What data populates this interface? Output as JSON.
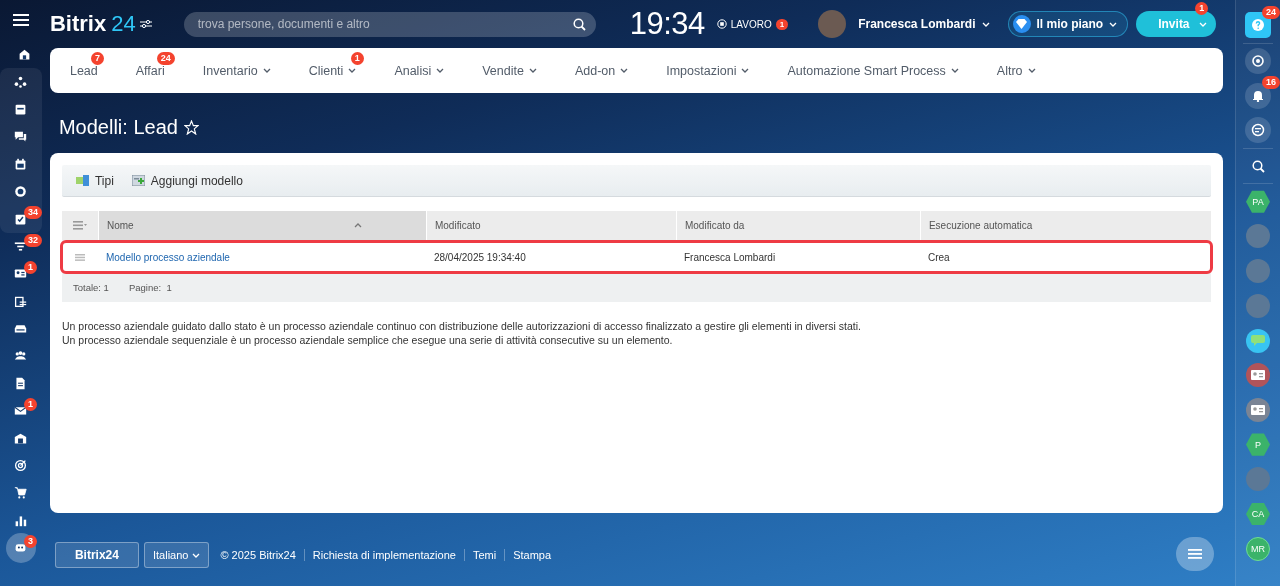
{
  "header": {
    "logo": {
      "word": "Bitrix",
      "number": "24"
    },
    "search": {
      "placeholder": "trova persone, documenti e altro"
    },
    "clock": "19:34",
    "work_status": {
      "label": "LAVORO",
      "badge": "1"
    },
    "user": {
      "name": "Francesca Lombardi"
    },
    "plan_button": "Il mio piano",
    "invite_button": {
      "label": "Invita",
      "badge": "1"
    }
  },
  "left_sidebar": {
    "badges": [
      "34",
      "32",
      "1",
      "1",
      "3"
    ]
  },
  "nav": {
    "items": [
      {
        "label": "Lead",
        "badge": "7",
        "dropdown": false
      },
      {
        "label": "Affari",
        "badge": "24",
        "dropdown": false
      },
      {
        "label": "Inventario",
        "dropdown": true
      },
      {
        "label": "Clienti",
        "badge": "1",
        "dropdown": true
      },
      {
        "label": "Analisi",
        "dropdown": true
      },
      {
        "label": "Vendite",
        "dropdown": true
      },
      {
        "label": "Add-on",
        "dropdown": true
      },
      {
        "label": "Impostazioni",
        "dropdown": true
      },
      {
        "label": "Automazione Smart Process",
        "dropdown": true
      },
      {
        "label": "Altro",
        "dropdown": true
      }
    ]
  },
  "page_title": "Modelli: Lead",
  "toolbar": [
    "Tipi",
    "Aggiungi modello"
  ],
  "table": {
    "columns": [
      {
        "label": "Nome",
        "sorted": true
      },
      {
        "label": "Modificato",
        "sorted": false
      },
      {
        "label": "Modificato da",
        "sorted": false
      },
      {
        "label": "Esecuzione automatica",
        "sorted": false
      }
    ],
    "rows": [
      {
        "highlighted": true,
        "cells": [
          "Modello processo aziendale",
          "28/04/2025 19:34:40",
          "Francesca Lombardi",
          "Crea"
        ]
      }
    ],
    "total_label": "Totale: 1",
    "pages_label": "Pagine:",
    "pages_value": "1"
  },
  "description": [
    "Un processo aziendale guidato dallo stato è un processo aziendale continuo con distribuzione delle autorizzazioni di accesso finalizzato a gestire gli elementi in diversi stati.",
    "Un processo aziendale sequenziale è un processo aziendale semplice che esegue una serie di attività consecutive su un elemento."
  ],
  "footer": {
    "logo": "Bitrix24",
    "language": "Italiano",
    "links": [
      "© 2025 Bitrix24",
      "Richiesta di implementazione",
      "Temi",
      "Stampa"
    ]
  },
  "right_sidebar": {
    "help_badge": "24",
    "bell_badge": "16",
    "contacts": [
      {
        "kind": "hex",
        "initials": "PA"
      },
      {
        "kind": "photo"
      },
      {
        "kind": "photo"
      },
      {
        "kind": "photo"
      },
      {
        "kind": "chat"
      },
      {
        "kind": "card",
        "color": "#b0545a"
      },
      {
        "kind": "card",
        "color": "#7a8494"
      },
      {
        "kind": "hex",
        "initials": "P"
      },
      {
        "kind": "photo"
      },
      {
        "kind": "hex",
        "initials": "CA"
      },
      {
        "kind": "circle",
        "initials": "MR"
      }
    ]
  }
}
